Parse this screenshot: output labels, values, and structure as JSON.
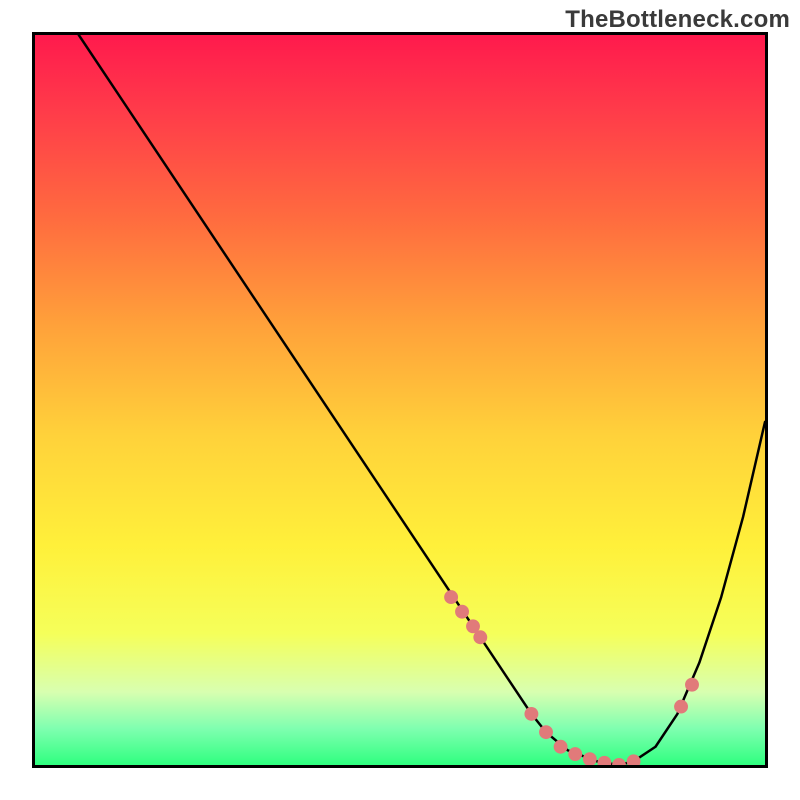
{
  "watermark": "TheBottleneck.com",
  "chart_data": {
    "type": "line",
    "title": "",
    "xlabel": "",
    "ylabel": "",
    "xlim": [
      0,
      100
    ],
    "ylim": [
      0,
      100
    ],
    "grid": false,
    "legend": false,
    "curves": [
      {
        "name": "bottleneck-curve",
        "x": [
          6,
          10,
          15,
          20,
          25,
          30,
          35,
          40,
          45,
          50,
          55,
          60,
          62,
          65,
          68,
          70,
          73,
          77,
          80,
          82,
          85,
          88,
          91,
          94,
          97,
          100
        ],
        "y": [
          100,
          94,
          86.5,
          79,
          71.5,
          64,
          56.5,
          49,
          41.5,
          34,
          26.5,
          19,
          16,
          11.5,
          7,
          4.5,
          2,
          0.5,
          0,
          0.5,
          2.5,
          7,
          14,
          23,
          34,
          47
        ]
      }
    ],
    "scatter": [
      {
        "name": "highlight-points",
        "color": "#e17a7a",
        "x": [
          57,
          58.5,
          60,
          61,
          68,
          70,
          72,
          74,
          76,
          78,
          80,
          82,
          88.5,
          90
        ],
        "y": [
          23,
          21,
          19,
          17.5,
          7,
          4.5,
          2.5,
          1.5,
          0.8,
          0.3,
          0,
          0.5,
          8,
          11
        ]
      }
    ],
    "gradient_stops": [
      {
        "pos": 0,
        "color": "#ff1a4d"
      },
      {
        "pos": 25,
        "color": "#ff6b3f"
      },
      {
        "pos": 55,
        "color": "#ffd23a"
      },
      {
        "pos": 82,
        "color": "#f5ff5a"
      },
      {
        "pos": 100,
        "color": "#2fff7f"
      }
    ]
  }
}
